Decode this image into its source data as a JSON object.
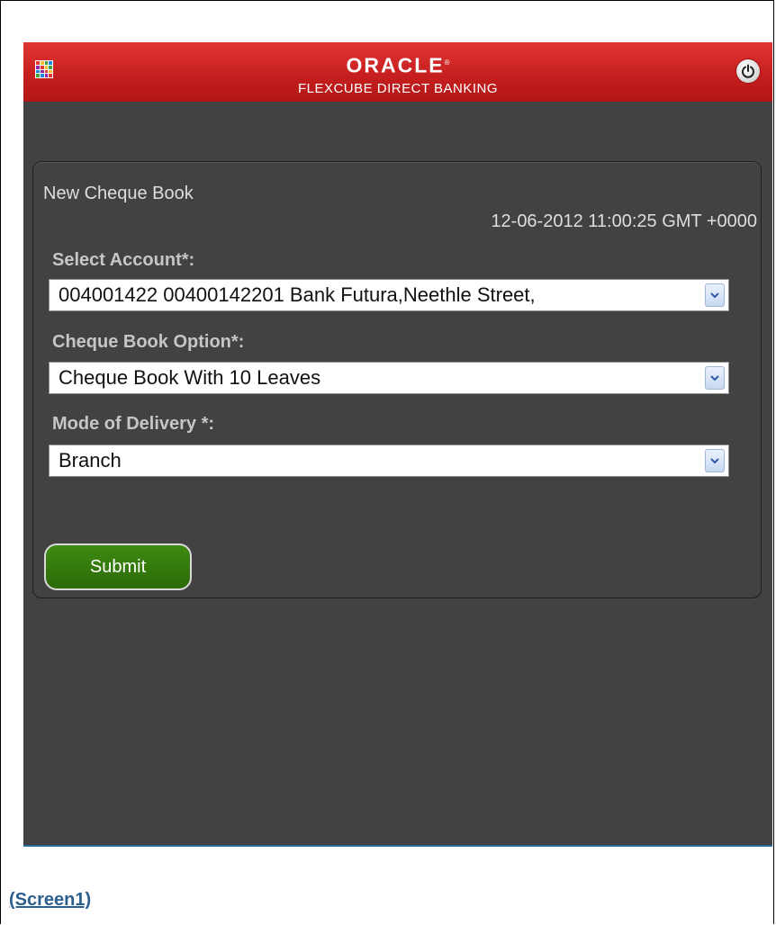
{
  "header": {
    "brand_logo": "ORACLE",
    "brand_tm": "®",
    "brand_subtitle": "FLEXCUBE DIRECT BANKING"
  },
  "form": {
    "title": "New Cheque Book",
    "timestamp": "12-06-2012 11:00:25 GMT +0000",
    "select_account": {
      "label": "Select Account*:",
      "value": " 004001422 00400142201 Bank Futura,Neethle Street,"
    },
    "cheque_book_option": {
      "label": "Cheque Book Option*:",
      "value": "Cheque Book With 10 Leaves"
    },
    "mode_of_delivery": {
      "label": "Mode of Delivery *:",
      "value": "Branch"
    },
    "submit_label": "Submit"
  },
  "caption": "(Screen1)",
  "colors": {
    "header_red": "#c71f1f",
    "background_dark": "#424242",
    "submit_green": "#2c6a08",
    "caption_blue": "#2d5f8e"
  }
}
